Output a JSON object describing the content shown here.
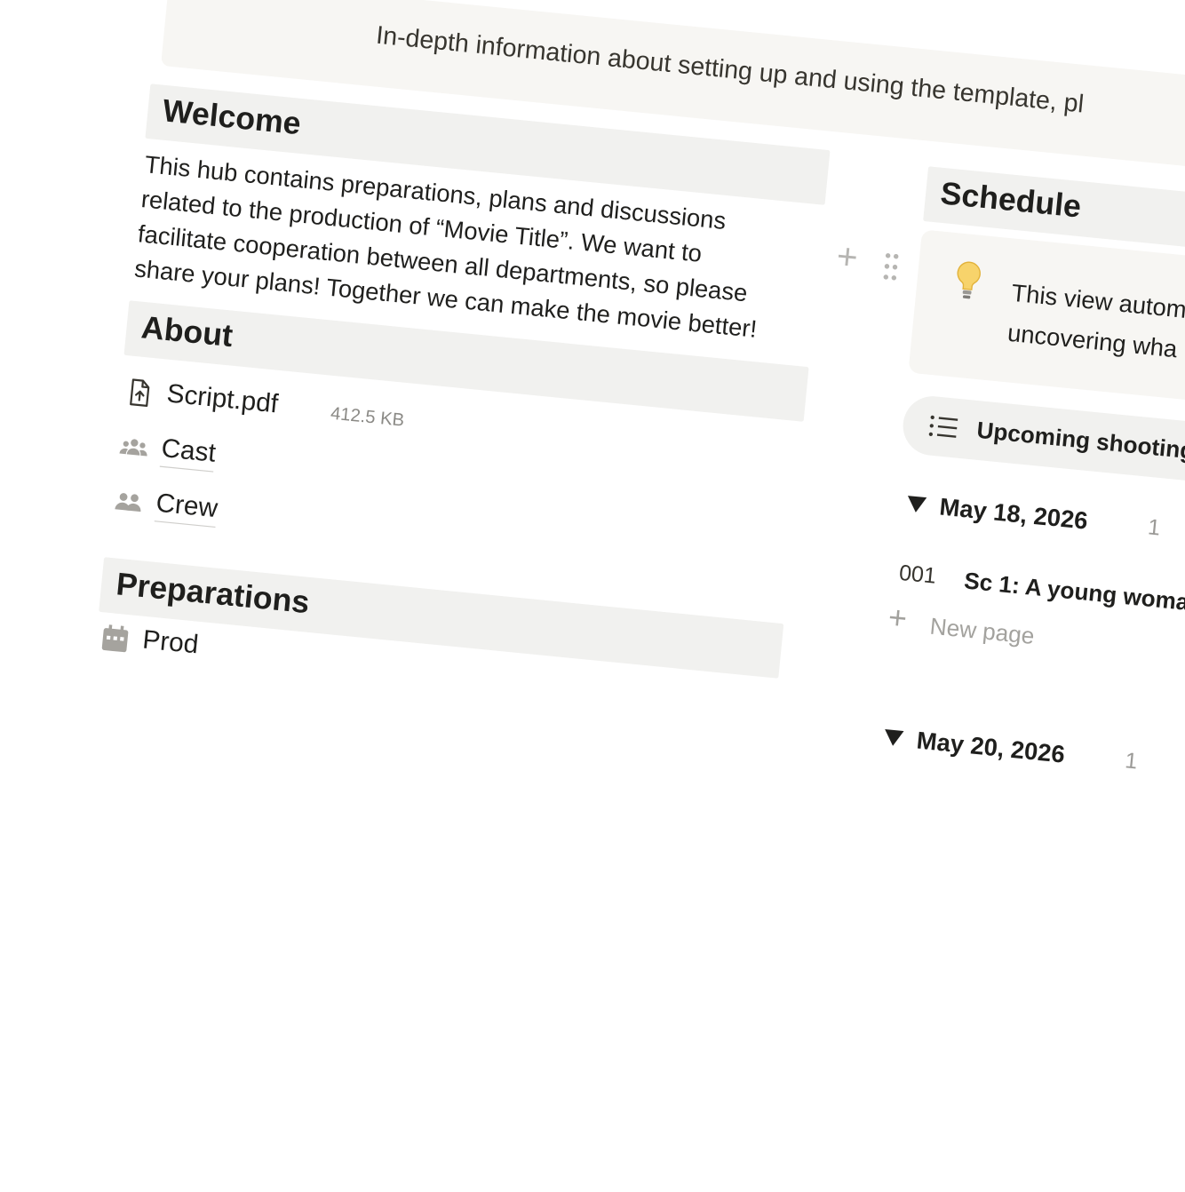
{
  "top_callout": {
    "text": "In-depth information about setting up and using the template, pl"
  },
  "welcome": {
    "heading": "Welcome",
    "body": "This hub contains preparations, plans and discussions related to the production of “Movie Title”. We want to facilitate cooperation between all departments, so please share your plans! Together we can make the movie better!"
  },
  "about": {
    "heading": "About",
    "items": [
      {
        "label": "Script.pdf",
        "meta": "412.5 KB",
        "icon": "file-upload-icon"
      },
      {
        "label": "Cast",
        "icon": "people-group-icon"
      },
      {
        "label": "Crew",
        "icon": "people-pair-icon"
      }
    ]
  },
  "preparations": {
    "heading": "Preparations",
    "items": [
      {
        "label": "Prod",
        "icon": "calendar-icon"
      }
    ]
  },
  "schedule": {
    "heading": "Schedule",
    "callout": {
      "icon": "lightbulb-icon",
      "line1": "This view autom",
      "line2": "uncovering wha"
    },
    "view_tab": {
      "icon": "list-icon",
      "label": "Upcoming shooting"
    },
    "groups": [
      {
        "date": "May 18, 2026",
        "count": "1",
        "items": [
          {
            "num": "001",
            "title": "Sc 1: A young woma"
          }
        ],
        "new_page": "New page"
      },
      {
        "date": "May 20, 2026",
        "count": "1"
      }
    ]
  },
  "colors": {
    "heading_bg": "#f1f1ef",
    "callout_bg": "#f7f6f3",
    "text": "#1f1f1d",
    "muted": "#9b9a97"
  }
}
